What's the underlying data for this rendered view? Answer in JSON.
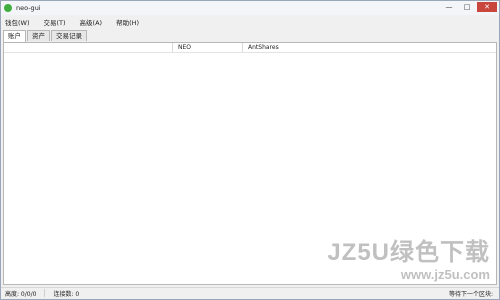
{
  "window": {
    "title": "neo-gui",
    "controls": {
      "minimize": "—",
      "maximize": "□",
      "close": "✕"
    }
  },
  "menu": [
    {
      "label": "钱包(W)"
    },
    {
      "label": "交易(T)"
    },
    {
      "label": "高级(A)"
    },
    {
      "label": "帮助(H)"
    }
  ],
  "tabs": [
    {
      "label": "账户",
      "active": true
    },
    {
      "label": "资产",
      "active": false
    },
    {
      "label": "交易记录",
      "active": false
    }
  ],
  "table": {
    "columns": [
      "NEO",
      "AntShares"
    ]
  },
  "status": {
    "height": "高度: 0/0/0",
    "connections": "连接数: 0",
    "next_block": "等待下一个区块:"
  },
  "watermark": {
    "line1": "JZ5U绿色下载",
    "line2": "www.jz5u.com"
  }
}
